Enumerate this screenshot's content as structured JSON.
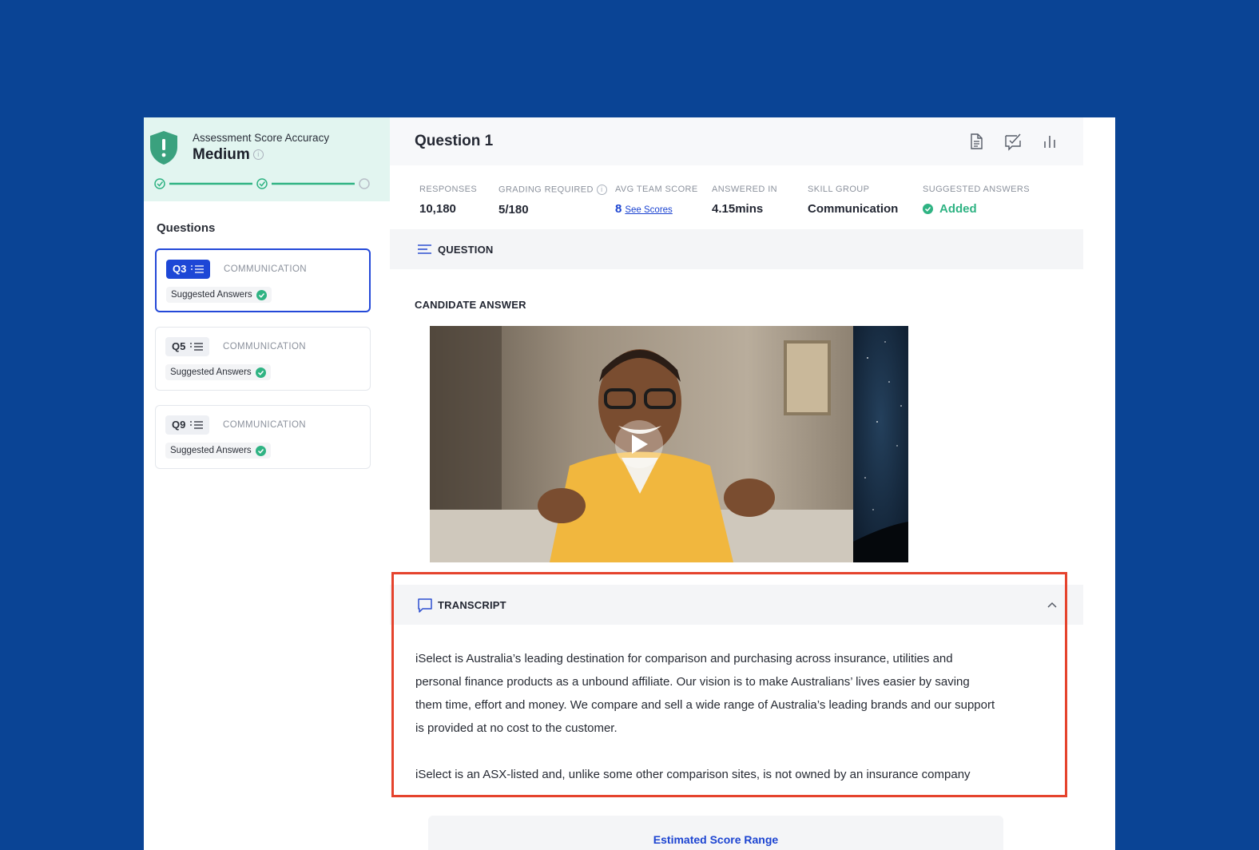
{
  "sidebar": {
    "accuracy": {
      "label": "Assessment Score Accuracy",
      "value": "Medium"
    },
    "questions_heading": "Questions",
    "questions": [
      {
        "tag": "Q3",
        "skill": "COMMUNICATION",
        "chip": "Suggested Answers",
        "active": true
      },
      {
        "tag": "Q5",
        "skill": "COMMUNICATION",
        "chip": "Suggested Answers",
        "active": false
      },
      {
        "tag": "Q9",
        "skill": "COMMUNICATION",
        "chip": "Suggested Answers",
        "active": false
      }
    ]
  },
  "main": {
    "title": "Question 1",
    "header_icons": [
      "document-icon",
      "checklist-icon",
      "bar-chart-icon"
    ],
    "stats": {
      "responses": {
        "label": "RESPONSES",
        "value": "10,180"
      },
      "grading": {
        "label": "GRADING REQUIRED",
        "value": "5/180"
      },
      "avg": {
        "label": "AVG TEAM SCORE",
        "value": "8",
        "link": "See Scores"
      },
      "answered": {
        "label": "ANSWERED IN",
        "value": "4.15mins"
      },
      "skill": {
        "label": "SKILL GROUP",
        "value": "Communication"
      },
      "suggested": {
        "label": "SUGGESTED ANSWERS",
        "value": "Added"
      }
    },
    "question_section": "QUESTION",
    "candidate_label": "CANDIDATE ANSWER",
    "transcript": {
      "label": "TRANSCRIPT",
      "paragraphs": [
        "iSelect is Australia’s leading destination for comparison and purchasing across insurance, utilities and personal finance products as a unbound affiliate. Our vision is to make Australians’ lives easier by saving them time, effort and money. We compare and sell a wide range of Australia’s leading brands and our support is provided at no cost to the customer.",
        "iSelect is an ASX-listed and, unlike some other comparison sites, is not owned by an insurance company"
      ]
    },
    "score_range_title": "Estimated Score Range"
  },
  "colors": {
    "page_bg": "#0A4495",
    "accent_blue": "#1D47D6",
    "success_green": "#2FB383",
    "highlight_red": "#E5432D"
  }
}
